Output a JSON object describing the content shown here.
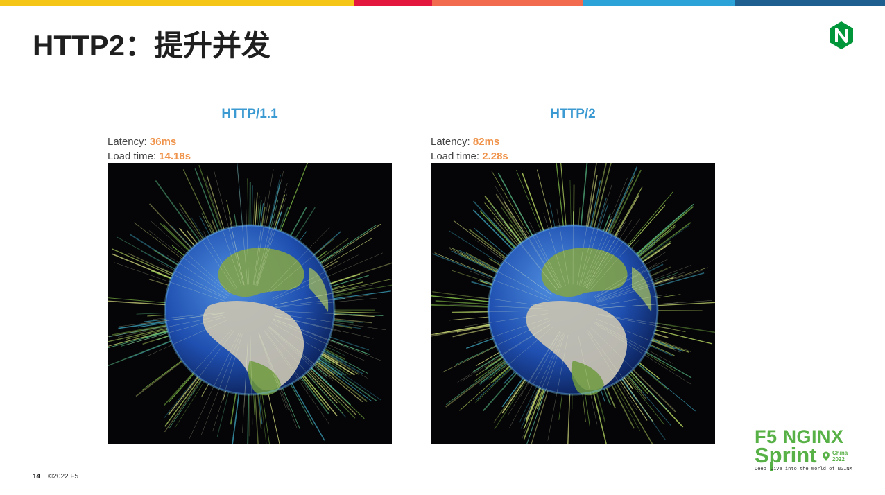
{
  "slide": {
    "title": "HTTP2：提升并发",
    "page_number": "14",
    "copyright": "©2022 F5"
  },
  "top_bar_colors": [
    "#f5c518",
    "#e4173e",
    "#f26b4e",
    "#2ba3d9",
    "#1f5f8f"
  ],
  "panels": [
    {
      "protocol": "HTTP/1.1",
      "latency_label": "Latency:",
      "latency_value": "36ms",
      "load_label": "Load time:",
      "load_value": "14.18s"
    },
    {
      "protocol": "HTTP/2",
      "latency_label": "Latency:",
      "latency_value": "82ms",
      "load_label": "Load time:",
      "load_value": "2.28s"
    }
  ],
  "event_logo": {
    "line1": "F5 NGINX",
    "line2": "Sprint",
    "location_1": "China",
    "location_2": "2022",
    "tagline_1": "Deep",
    "tagline_2": "Dive into the World of NGINX"
  },
  "colors": {
    "accent_blue": "#3b9ad2",
    "metric_orange": "#f0934a",
    "brand_green": "#58b146",
    "nginx_green": "#009639"
  },
  "icons": {
    "nginx": "nginx-hexagon-icon",
    "globe": "globe-visualization-image",
    "pin": "location-pin-icon"
  }
}
